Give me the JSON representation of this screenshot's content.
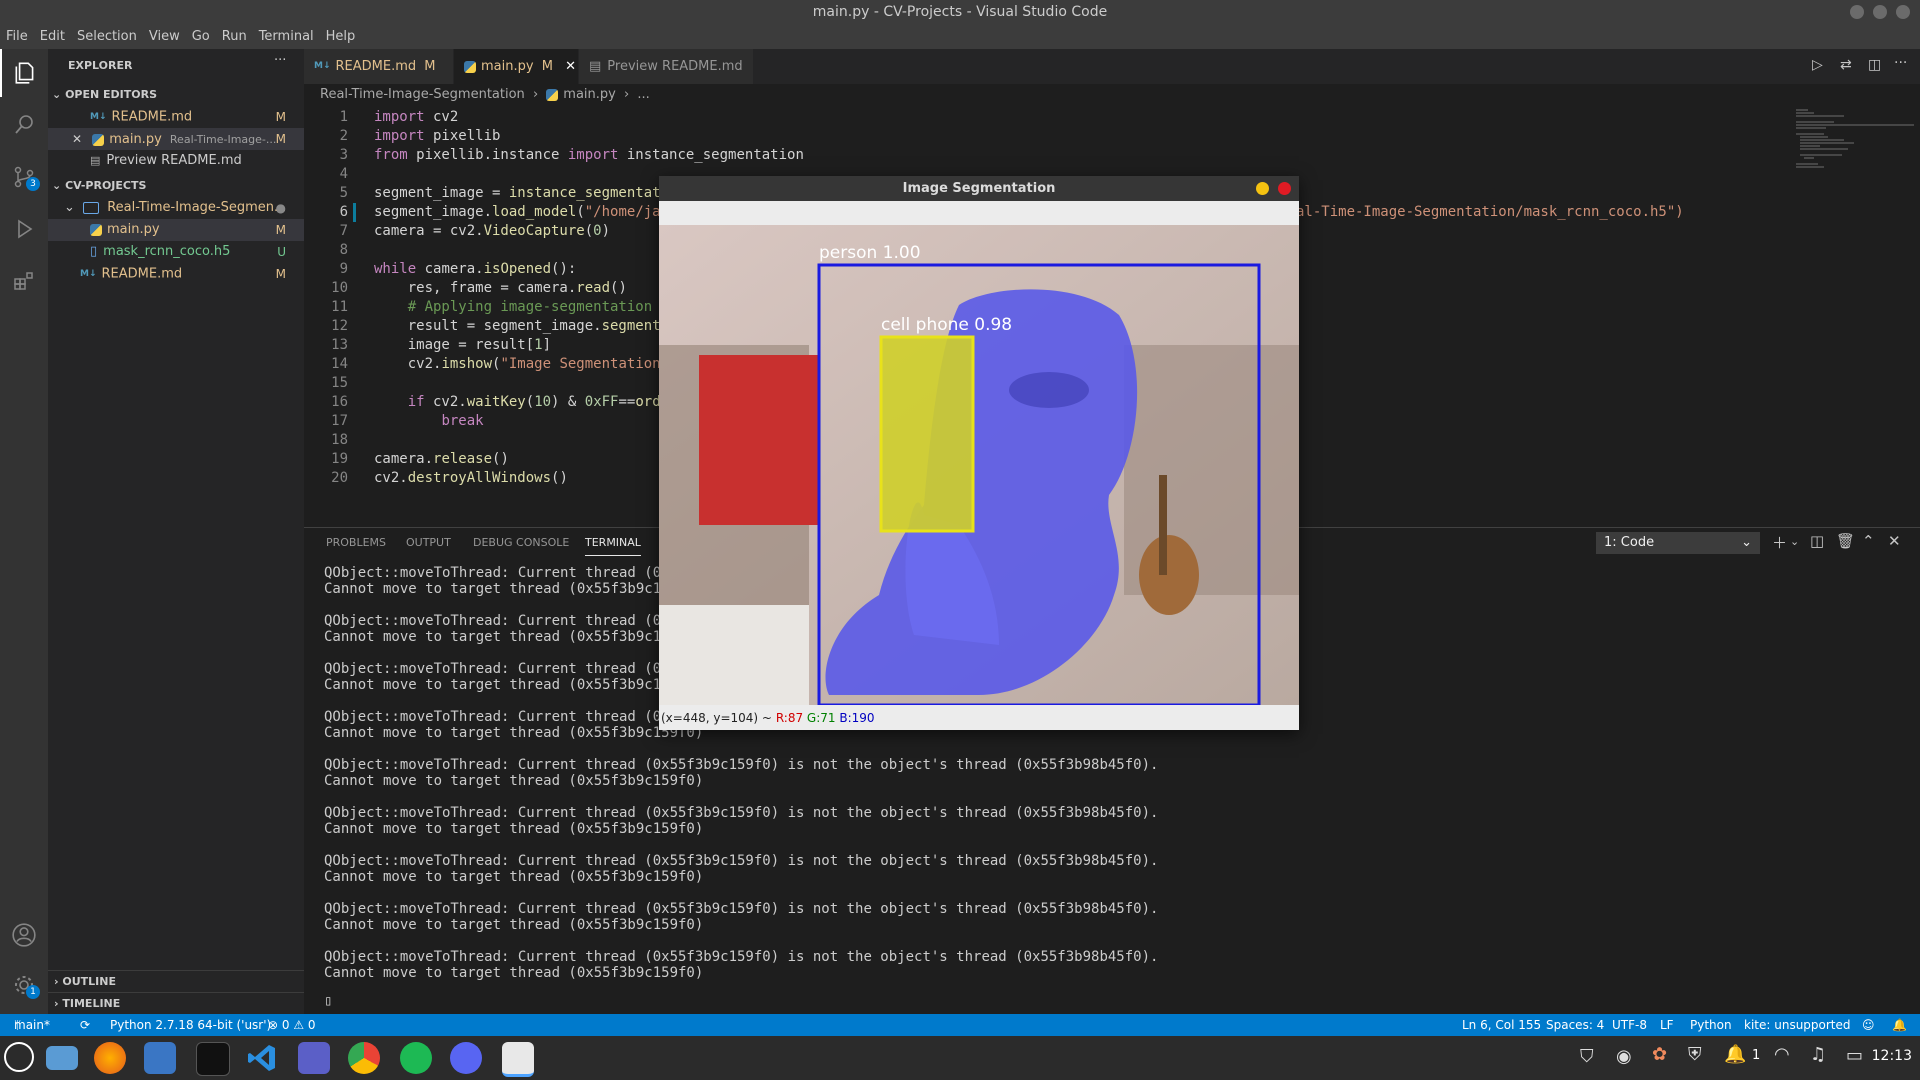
{
  "window": {
    "title": "main.py - CV-Projects - Visual Studio Code"
  },
  "menu": [
    "File",
    "Edit",
    "Selection",
    "View",
    "Go",
    "Run",
    "Terminal",
    "Help"
  ],
  "activity": {
    "scm_badge": "3",
    "settings_badge": "1"
  },
  "explorer": {
    "title": "EXPLORER",
    "more": "···",
    "open_editors_label": "OPEN EDITORS",
    "open_editors": [
      {
        "icon": "M↓",
        "name": "README.md",
        "desc": "",
        "mark": "M"
      },
      {
        "icon": "py",
        "name": "main.py",
        "desc": "Real-Time-Image-...",
        "mark": "M"
      },
      {
        "icon": "preview",
        "name": "Preview README.md",
        "desc": "",
        "mark": ""
      }
    ],
    "project_label": "CV-PROJECTS",
    "folder": "Real-Time-Image-Segmen...",
    "files": [
      {
        "name": "main.py",
        "mark": "M"
      },
      {
        "name": "mask_rcnn_coco.h5",
        "mark": "U"
      },
      {
        "name": "README.md",
        "mark": "M"
      }
    ],
    "outline_label": "OUTLINE",
    "timeline_label": "TIMELINE"
  },
  "tabs": [
    {
      "name": "README.md",
      "mark": "M"
    },
    {
      "name": "main.py",
      "mark": "M"
    },
    {
      "name": "Preview README.md",
      "mark": ""
    }
  ],
  "breadcrumb": {
    "folder": "Real-Time-Image-Segmentation",
    "file": "main.py",
    "more": "..."
  },
  "editor": {
    "line_numbers": [
      "1",
      "2",
      "3",
      "4",
      "5",
      "6",
      "7",
      "8",
      "9",
      "10",
      "11",
      "12",
      "13",
      "14",
      "15",
      "16",
      "17",
      "18",
      "19",
      "20"
    ],
    "current_line": "6",
    "right_fragment": "al-Time-Image-Segmentation/mask_rcnn_coco.h5\")"
  },
  "panel": {
    "tabs": [
      "PROBLEMS",
      "OUTPUT",
      "DEBUG CONSOLE",
      "TERMINAL"
    ],
    "terminal_select": "1: Code",
    "short_lines": [
      [
        "QObject::moveToThread: Current thread (0x5",
        "Cannot move to target thread (0x55f3b9c159"
      ],
      [
        "QObject::moveToThread: Current thread (0x5",
        "Cannot move to target thread (0x55f3b9c159"
      ],
      [
        "QObject::moveToThread: Current thread (0x5",
        "Cannot move to target thread (0x55f3b9c159"
      ],
      [
        "QObject::moveToThread: Current thread (0x5",
        "Cannot move to target thread (0x55f3b9c159f0)"
      ]
    ],
    "full_line_1": "QObject::moveToThread: Current thread (0x55f3b9c159f0) is not the object's thread (0x55f3b98b45f0).",
    "full_line_2": "Cannot move to target thread (0x55f3b9c159f0)",
    "full_count": 5,
    "cursor": "▯"
  },
  "statusbar": {
    "branch": "main*",
    "sync": "⟳",
    "interpreter": "Python 2.7.18 64-bit ('usr')",
    "problems": "⊗ 0 ⚠ 0",
    "position": "Ln 6, Col 155",
    "spaces": "Spaces: 4",
    "encoding": "UTF-8",
    "eol": "LF",
    "language": "Python",
    "kite": "kite: unsupported"
  },
  "cv_window": {
    "title": "Image Segmentation",
    "label_person": "person 1.00",
    "label_phone": "cell phone 0.98",
    "status_pos": "(x=448, y=104) ~",
    "status_r": "R:87",
    "status_g": "G:71",
    "status_b": "B:190"
  },
  "taskbar": {
    "clock": "12:13",
    "notif_count": "1"
  },
  "colors": {
    "accent": "#007acc",
    "modified": "#e2c08d",
    "person_box": "#1a1ae0",
    "phone_box": "#e8e21a",
    "person_mask": "#5a5ae8"
  }
}
